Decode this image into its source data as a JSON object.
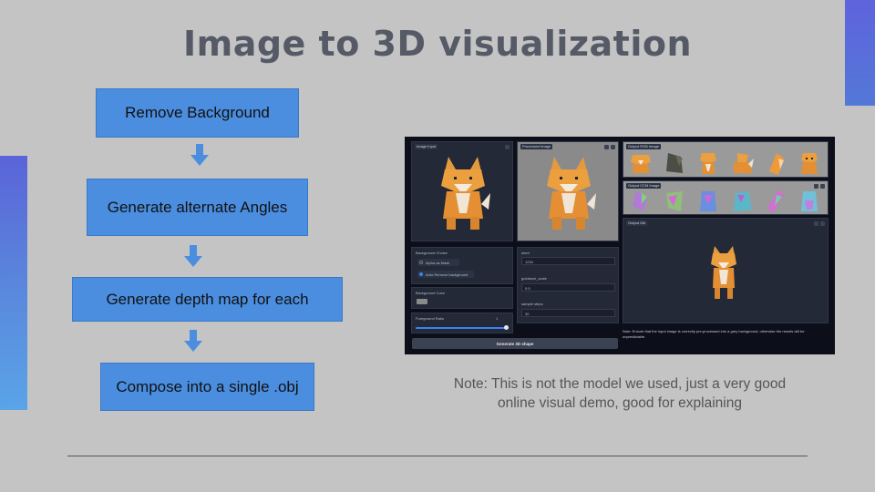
{
  "title": "Image to 3D visualization",
  "steps": [
    "Remove Background",
    "Generate alternate Angles",
    "Generate depth map for each",
    "Compose into a single .obj"
  ],
  "note": "Note: This is not the model we used, just a very good online visual demo, good for explaining",
  "colors": {
    "background": "#c4c4c4",
    "step_box": "#4b8ee0",
    "arrow": "#4b8ee0",
    "title": "#555a66",
    "accent": "#5a64d8"
  },
  "app": {
    "image_input_label": "Image Input",
    "processed_image_label": "Processed Image",
    "output_rgb_label": "Output RGB Image",
    "output_ccm_label": "Output CCM Image",
    "output_glb_label": "Output Glb",
    "background_choice_label": "Background Choice",
    "bg_option_alpha": "Alpha as Mask",
    "bg_option_auto": "Auto Remove background",
    "background_color_label": "Background Color",
    "foreground_ratio_label": "Foreground Ratio",
    "foreground_ratio_value": "1",
    "foreground_ratio_fraction": 0.98,
    "seed_label": "seed",
    "seed_value": "1234",
    "guidance_label": "guidance_scale",
    "guidance_value": "5.5",
    "steps_label": "sample steps",
    "steps_value": "30",
    "generate_label": "Generate 3D shape",
    "note": "Note: Ensure that the input image is correctly pre-processed into a grey background, otherwise the results will be unpredictable."
  }
}
